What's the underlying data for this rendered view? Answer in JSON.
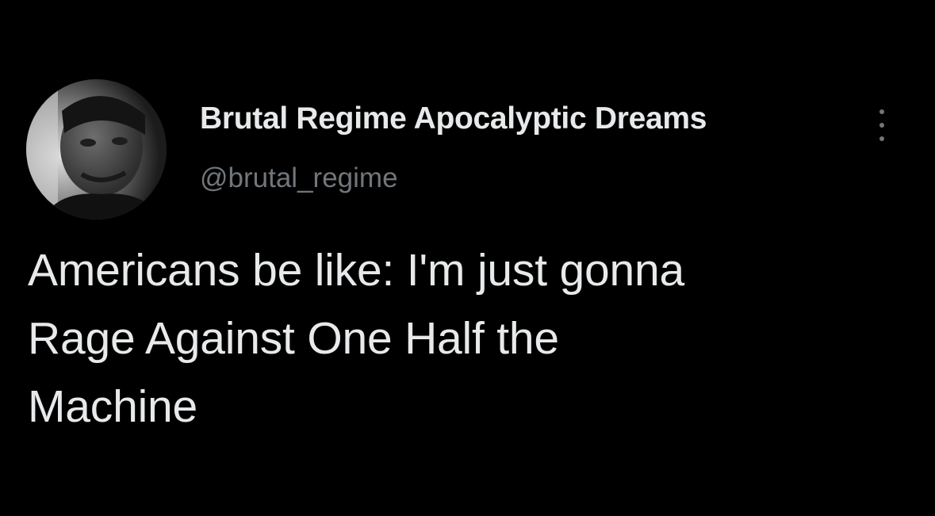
{
  "tweet": {
    "author": {
      "display_name": "Brutal Regime Apocalyptic Dreams",
      "handle": "@brutal_regime",
      "avatar_icon": "profile-photo"
    },
    "text_lines": [
      "Americans be like: I'm just gonna",
      "Rage Against One Half the",
      "Machine"
    ],
    "more_icon": "vertical-ellipsis-icon"
  },
  "colors": {
    "background": "#000000",
    "primary_text": "#e7e9ea",
    "secondary_text": "#71767b"
  }
}
